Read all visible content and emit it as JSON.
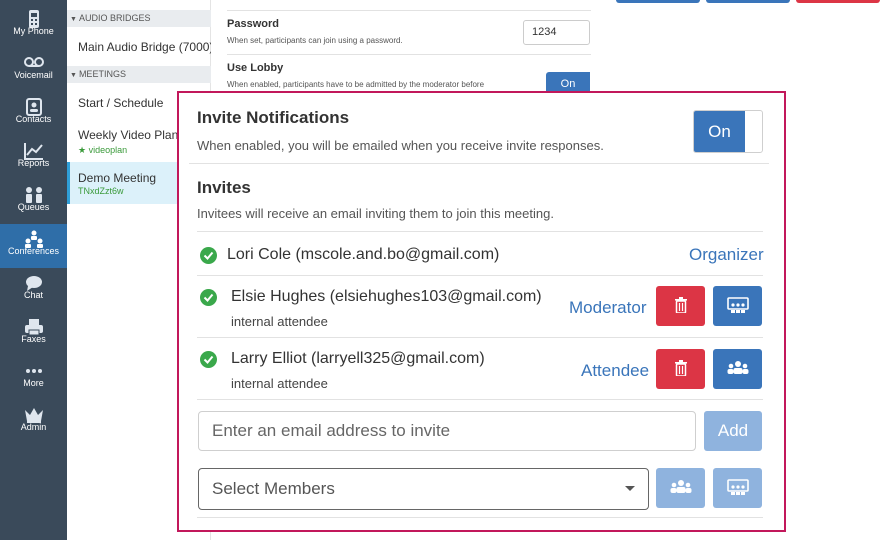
{
  "nav": {
    "items": [
      {
        "label": "My Phone",
        "icon": "phone-icon"
      },
      {
        "label": "Voicemail",
        "icon": "voicemail-icon"
      },
      {
        "label": "Contacts",
        "icon": "contacts-icon"
      },
      {
        "label": "Reports",
        "icon": "reports-icon"
      },
      {
        "label": "Queues",
        "icon": "queues-icon"
      },
      {
        "label": "Conferences",
        "icon": "conferences-icon",
        "active": true
      },
      {
        "label": "Chat",
        "icon": "chat-icon"
      },
      {
        "label": "Faxes",
        "icon": "fax-icon"
      },
      {
        "label": "More",
        "icon": "more-icon"
      },
      {
        "label": "Admin",
        "icon": "crown-icon"
      }
    ]
  },
  "subnav": {
    "audio_bridges_header": "AUDIO BRIDGES",
    "audio_bridge_item": "Main Audio Bridge (7000)",
    "meetings_header": "MEETINGS",
    "start_schedule": "Start / Schedule",
    "weekly_meeting": {
      "name": "Weekly Video Planni",
      "meta": "videoplan"
    },
    "demo_meeting": {
      "name": "Demo Meeting",
      "meta": "TNxdZzt6w"
    }
  },
  "settings": {
    "password_title": "Password",
    "password_desc": "When set, participants can join using a password.",
    "password_value": "1234",
    "lobby_title": "Use Lobby",
    "lobby_desc": "When enabled, participants have to be admitted by the moderator before",
    "lobby_toggle": "On"
  },
  "invite_notifications": {
    "title": "Invite Notifications",
    "desc": "When enabled, you will be emailed when you receive invite responses.",
    "toggle": "On"
  },
  "invites": {
    "title": "Invites",
    "desc": "Invitees will receive an email inviting them to join this meeting.",
    "list": [
      {
        "name": "Lori Cole (mscole.and.bo@gmail.com)",
        "sub": "",
        "role": "Organizer"
      },
      {
        "name": "Elsie Hughes (elsiehughes103@gmail.com)",
        "sub": "internal attendee",
        "role": "Moderator"
      },
      {
        "name": "Larry Elliot (larryell325@gmail.com)",
        "sub": "internal attendee",
        "role": "Attendee"
      }
    ],
    "email_placeholder": "Enter an email address to invite",
    "add_label": "Add",
    "select_members": "Select Members"
  },
  "colors": {
    "nav_bg": "#3a4a5a",
    "nav_active": "#2f6ea8",
    "primary": "#3a75ba",
    "danger": "#dc3545",
    "success": "#3aa84b",
    "highlight_border": "#c2185b"
  }
}
